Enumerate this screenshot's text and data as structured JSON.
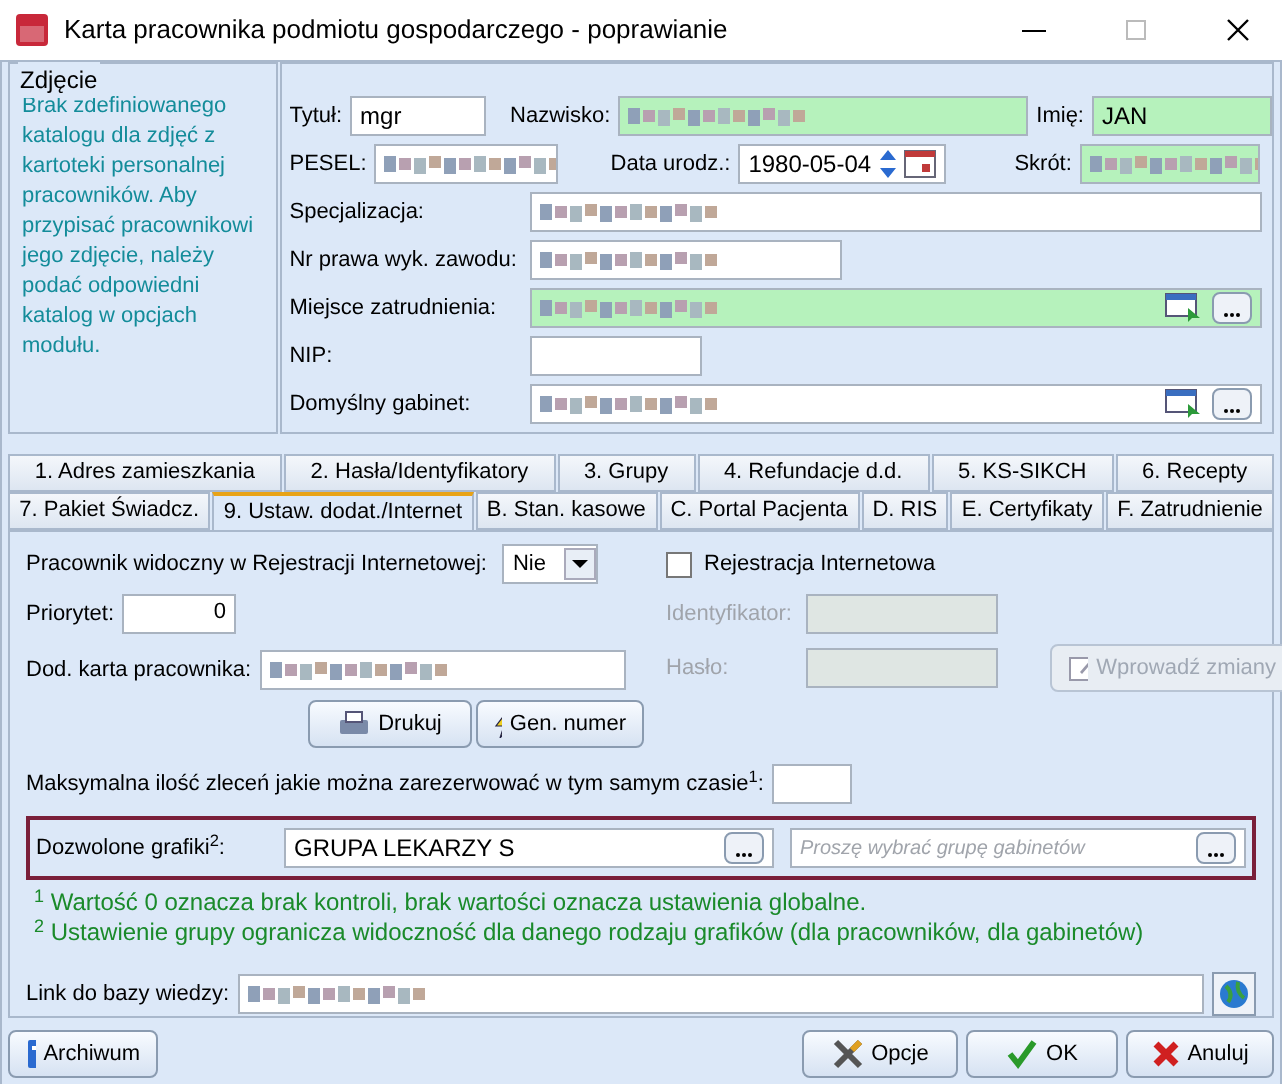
{
  "window": {
    "title": "Karta pracownika podmiotu gospodarczego - poprawianie"
  },
  "photo": {
    "legend": "Zdjęcie",
    "message": "Brak zdefiniowanego katalogu dla zdjęć z kartoteki personalnej pracowników. Aby przypisać pracownikowi jego zdjęcie, należy podać odpowiedni katalog w opcjach modułu."
  },
  "person": {
    "title": {
      "label": "Tytuł:",
      "value": "mgr",
      "required": false
    },
    "surname": {
      "label": "Nazwisko:",
      "redacted": true,
      "required": true
    },
    "first_name": {
      "label": "Imię:",
      "value": "JAN",
      "required": true
    },
    "pesel": {
      "label": "PESEL:",
      "redacted": true,
      "required": false
    },
    "birth_date": {
      "label": "Data urodz.:",
      "value": "1980-05-04",
      "required": false
    },
    "short": {
      "label": "Skrót:",
      "redacted": true,
      "required": true
    },
    "rows": [
      {
        "label": "Specjalizacja:",
        "redacted": true,
        "required": false,
        "kind": "wide"
      },
      {
        "label": "Nr prawa wyk. zawodu:",
        "redacted": true,
        "required": false,
        "kind": "medium"
      },
      {
        "label": "Miejsce zatrudnienia:",
        "redacted": true,
        "required": true,
        "kind": "picker"
      },
      {
        "label": "NIP:",
        "required": false,
        "kind": "short"
      },
      {
        "label": "Domyślny gabinet:",
        "redacted": true,
        "required": false,
        "kind": "picker"
      }
    ]
  },
  "tabs": [
    [
      {
        "label": "1. Adres zamieszkania",
        "selected": false
      },
      {
        "label": "2. Hasła/Identyfikatory",
        "selected": false
      },
      {
        "label": "3. Grupy",
        "selected": false
      },
      {
        "label": "4. Refundacje d.d.",
        "selected": false
      },
      {
        "label": "5. KS-SIKCH",
        "selected": false
      },
      {
        "label": "6. Recepty",
        "selected": false
      }
    ],
    [
      {
        "label": "7. Pakiet Świadcz.",
        "selected": false
      },
      {
        "label": "9. Ustaw. dodat./Internet",
        "selected": true
      },
      {
        "label": "B. Stan. kasowe",
        "selected": false
      },
      {
        "label": "C. Portal Pacjenta",
        "selected": false
      },
      {
        "label": "D. RIS",
        "selected": false
      },
      {
        "label": "E. Certyfikaty",
        "selected": false
      },
      {
        "label": "F. Zatrudnienie",
        "selected": false
      }
    ]
  ],
  "internet": {
    "visible": {
      "label": "Pracownik widoczny w Rejestracji Internetowej:",
      "value": "Nie"
    },
    "priority": {
      "label": "Priorytet:",
      "value": "0"
    },
    "card": {
      "label": "Dod. karta pracownika:",
      "redacted": true
    },
    "print_button": "Drukuj",
    "generate_button": "Gen. numer",
    "registration": {
      "label": "Rejestracja Internetowa",
      "checked": false
    },
    "identifier": {
      "label": "Identyfikator:",
      "disabled": true
    },
    "password": {
      "label": "Hasło:",
      "disabled": true
    },
    "apply_button": {
      "label": "Wprowadź zmiany",
      "disabled": true
    },
    "max_orders": {
      "label": "Maksymalna ilość zleceń jakie można zarezerwować w tym samym czasie$^{1}$:"
    },
    "schedules": {
      "label": "Dozwolone grafiki$^{2}$:",
      "value": "GRUPA LEKARZY S",
      "placeholder": "Proszę wybrać grupę gabinetów"
    },
    "notes": [
      "$^{1}$ Wartość 0 oznacza brak kontroli, brak wartości oznacza ustawienia globalne.",
      "$^{2}$ Ustawienie grupy ogranicza widoczność dla danego rodzaju grafików (dla pracowników, dla gabinetów)"
    ],
    "kb_link": {
      "label": "Link do bazy wiedzy:",
      "redacted": true
    }
  },
  "footer": {
    "archive": "Archiwum",
    "options": "Opcje",
    "ok": "OK",
    "cancel": "Anuluj"
  }
}
